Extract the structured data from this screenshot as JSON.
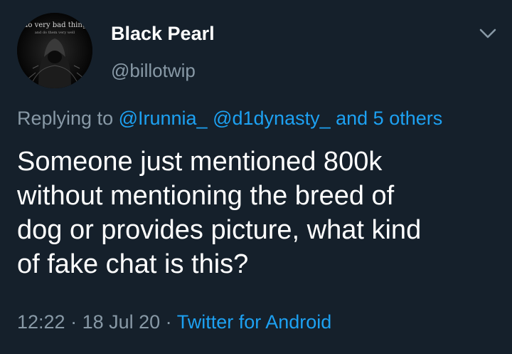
{
  "tweet": {
    "avatar": {
      "caption": "i do very bad things",
      "subcaption": "and do them very well"
    },
    "author": {
      "display_name": "Black Pearl",
      "handle": "@billotwip"
    },
    "menu_icon": "chevron-down-icon",
    "reply_context": {
      "prefix": "Replying to ",
      "mention_1": "@Irunnia_",
      "mention_2": "@d1dynasty_",
      "others": "and 5 others"
    },
    "text_lines": [
      "Someone just mentioned 800k",
      "without mentioning the breed of",
      "dog or provides picture, what kind",
      "of fake chat is this?"
    ],
    "meta": {
      "time": "12:22",
      "separator": " · ",
      "date": "18 Jul 20",
      "source": "Twitter for Android"
    }
  },
  "colors": {
    "background": "#15202b",
    "text_primary": "#ffffff",
    "text_secondary": "#8899a6",
    "link": "#1da1f2"
  }
}
